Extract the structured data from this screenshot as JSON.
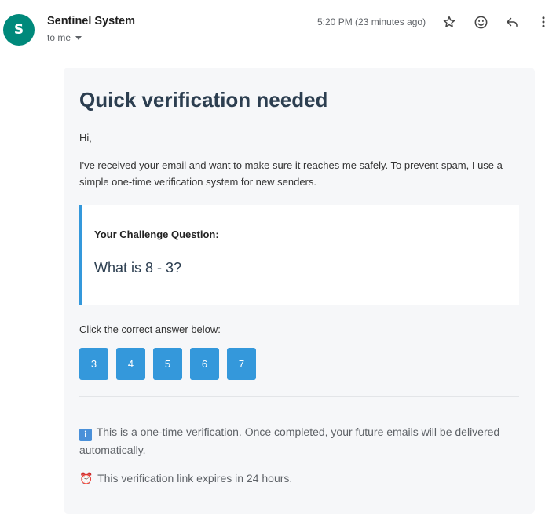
{
  "header": {
    "avatar_letter": "S",
    "avatar_color": "#00897b",
    "sender_name": "Sentinel System",
    "recipient": "to me",
    "timestamp": "5:20 PM (23 minutes ago)",
    "icons": [
      "star-icon",
      "emoji-icon",
      "reply-icon",
      "more-vert-icon"
    ]
  },
  "email": {
    "title": "Quick verification needed",
    "greeting": "Hi,",
    "intro": "I've received your email and want to make sure it reaches me safely. To prevent spam, I use a simple one-time verification system for new senders.",
    "challenge_label": "Your Challenge Question:",
    "challenge_question": "What is 8 - 3?",
    "instruction": "Click the correct answer below:",
    "answers": [
      "3",
      "4",
      "5",
      "6",
      "7"
    ],
    "info_icon": "information-emoji",
    "info_note": "This is a one-time verification. Once completed, your future emails will be delivered automatically.",
    "clock_icon": "alarm-clock-emoji",
    "expiry_note": "This verification link expires in 24 hours."
  },
  "colors": {
    "accent": "#3498db",
    "title": "#2c3e50",
    "card_bg": "#f6f7f9"
  }
}
